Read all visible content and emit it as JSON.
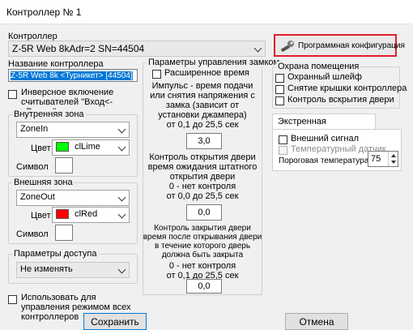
{
  "window": {
    "title": "Контроллер № 1"
  },
  "controller": {
    "label": "Контроллер",
    "selected": "Z-5R Web 8kAdr=2 SN=44504",
    "program_config_label": "Программная конфигурация"
  },
  "name": {
    "label": "Название контроллера",
    "value": "Z-5R Web 8k <Турникет> [44504]"
  },
  "inverse_readers": {
    "label": "Инверсное включение считывателей \"Вход<->Выход\""
  },
  "inner_zone": {
    "legend": "Внутренняя зона",
    "zone": "ZoneIn",
    "color_label": "Цвет",
    "color_name": "clLime",
    "color_hex": "#00ff00",
    "symbol_label": "Символ",
    "symbol_value": ""
  },
  "outer_zone": {
    "legend": "Внешняя зона",
    "zone": "ZoneOut",
    "color_label": "Цвет",
    "color_name": "clRed",
    "color_hex": "#ff0000",
    "symbol_label": "Символ",
    "symbol_value": ""
  },
  "access": {
    "legend": "Параметры доступа",
    "selected": "Не изменять"
  },
  "use_for_all": {
    "label": "Использовать для управления режимом всех контроллеров"
  },
  "lock": {
    "legend": "Параметры управления замком",
    "extended_time": "Расширенное время",
    "impulse_text": "Импульс - время подачи или снятия напряжения с замка (зависит от установки джампера)",
    "impulse_range": "от 0,1 до 25,5 сек",
    "impulse_value": "3,0",
    "open_text": "Контроль открытия двери время ожидания штатного открытия двери",
    "open_nocontrol": "0 - нет контроля",
    "open_range": "от 0,0 до 25,5 сек",
    "open_value": "0,0",
    "close_text": "Контроль закрытия двери время после открывания двери в течение которого дверь должна быть закрыта",
    "close_nocontrol": "0 - нет контроля",
    "close_range": "от 0,1 до 25,5 сек",
    "close_value": "0,0"
  },
  "security": {
    "legend": "Охрана помещения",
    "items": [
      "Охранный шлейф",
      "Снятие крышки контроллера",
      "Контроль вскрытия двери"
    ]
  },
  "evac": {
    "tab": "Экстренная эвакуация",
    "external_signal": "Внешний сигнал",
    "temp_sensor": "Температурный датчик",
    "threshold_label": "Пороговая температура :",
    "threshold_value": "75"
  },
  "buttons": {
    "save": "Сохранить",
    "cancel": "Отмена"
  },
  "colors": {
    "highlight": "#e0202a",
    "selection": "#0078d7"
  }
}
